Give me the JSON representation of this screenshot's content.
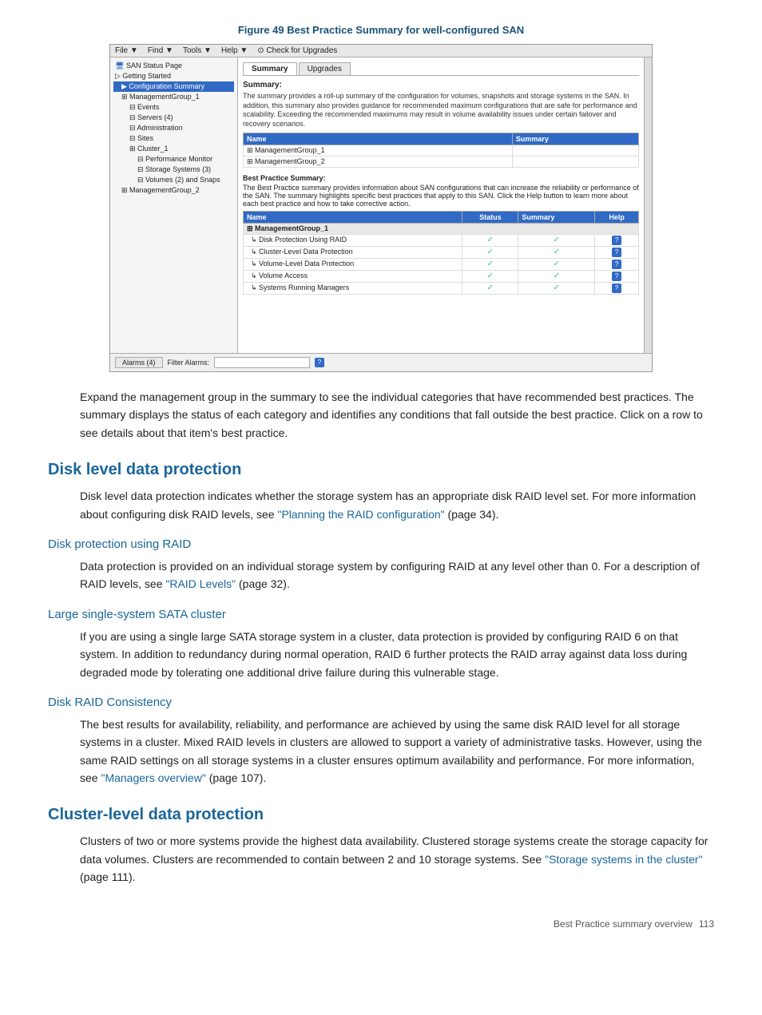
{
  "figure": {
    "caption": "Figure 49 Best Practice Summary for well-configured SAN"
  },
  "screenshot": {
    "menubar": [
      "File ▼",
      "Find ▼",
      "Tools ▼",
      "Help ▼",
      "⊙ Check for Upgrades"
    ],
    "sidebar": {
      "items": [
        {
          "label": "SAN Status Page",
          "level": 0
        },
        {
          "label": "Getting Started",
          "level": 0
        },
        {
          "label": "Configuration Summary",
          "level": 1,
          "selected": true
        },
        {
          "label": "ManagementGroup_1",
          "level": 1
        },
        {
          "label": "Events",
          "level": 2
        },
        {
          "label": "Servers (4)",
          "level": 2
        },
        {
          "label": "Administration",
          "level": 2
        },
        {
          "label": "Sites",
          "level": 2
        },
        {
          "label": "Cluster_1",
          "level": 2
        },
        {
          "label": "Performance Monitor",
          "level": 3
        },
        {
          "label": "Storage Systems (3)",
          "level": 3
        },
        {
          "label": "Volumes (2) and Snaps",
          "level": 3
        },
        {
          "label": "ManagementGroup_2",
          "level": 1
        }
      ]
    },
    "tabs": [
      "Summary",
      "Upgrades"
    ],
    "active_tab": "Summary",
    "summary": {
      "title": "Summary:",
      "description": "The summary provides a roll-up summary of the configuration for volumes, snapshots and storage systems in the SAN. In addition, this summary also provides guidance for recommended maximum configurations that are safe for performance and scalability. Exceeding the recommended maximums may result in volume availability issues under certain failover and recovery scenarios.",
      "table": {
        "headers": [
          "Name",
          "Summary"
        ],
        "rows": [
          {
            "name": "ManagementGroup_1",
            "summary": ""
          },
          {
            "name": "ManagementGroup_2",
            "summary": ""
          }
        ]
      }
    },
    "best_practice": {
      "title": "Best Practice Summary:",
      "description": "The Best Practice summary provides information about SAN configurations that can increase the reliability or performance of the SAN. The summary highlights specific best practices that apply to this SAN. Click the Help button to learn more about each best practice and how to take corrective action.",
      "table": {
        "headers": [
          "Name",
          "Status",
          "Summary",
          "Help"
        ],
        "rows": [
          {
            "name": "ManagementGroup_1",
            "is_header": true
          },
          {
            "name": "Disk Protection Using RAID",
            "status": "✓",
            "summary": "✓",
            "help": "?"
          },
          {
            "name": "Cluster-Level Data Protection",
            "status": "✓",
            "summary": "✓",
            "help": "?"
          },
          {
            "name": "Volume-Level Data Protection",
            "status": "✓",
            "summary": "✓",
            "help": "?"
          },
          {
            "name": "Volume Access",
            "status": "✓",
            "summary": "✓",
            "help": "?"
          },
          {
            "name": "Systems Running Managers",
            "status": "✓",
            "summary": "✓",
            "help": "?"
          }
        ]
      }
    },
    "alarms": {
      "tab_label": "Alarms (4)",
      "filter_label": "Filter Alarms:"
    }
  },
  "body": {
    "expand_text": "Expand the management group in the summary to see the individual categories that have recommended best practices. The summary displays the status of each category and identifies any conditions that fall outside the best practice. Click on a row to see details about that item's best practice.",
    "disk_level": {
      "heading": "Disk level data protection",
      "text": "Disk level data protection indicates whether the storage system has an appropriate disk RAID level set. For more information about configuring disk RAID levels, see ",
      "link_text": "\"Planning the RAID configuration\"",
      "link_page": "(page 34)."
    },
    "disk_protection": {
      "heading": "Disk protection using RAID",
      "text": "Data protection is provided on an individual storage system by configuring RAID at any level other than 0. For a description of RAID levels, see ",
      "link_text": "\"RAID Levels\"",
      "link_page": "(page 32)."
    },
    "large_sata": {
      "heading": "Large single-system SATA cluster",
      "text": "If you are using a single large SATA storage system in a cluster, data protection is provided by configuring RAID 6 on that system. In addition to redundancy during normal operation, RAID 6 further protects the RAID array against data loss during degraded mode by tolerating one additional drive failure during this vulnerable stage."
    },
    "disk_raid": {
      "heading": "Disk RAID Consistency",
      "text": "The best results for availability, reliability, and performance are achieved by using the same disk RAID level for all storage systems in a cluster. Mixed RAID levels in clusters are allowed to support a variety of administrative tasks. However, using the same RAID settings on all storage systems in a cluster ensures optimum availability and performance. For more information, see ",
      "link_text": "\"Managers overview\"",
      "link_page": "(page 107)."
    },
    "cluster_level": {
      "heading": "Cluster-level data protection",
      "text": "Clusters of two or more systems provide the highest data availability. Clustered storage systems create the storage capacity for data volumes. Clusters are recommended to contain between 2 and 10 storage systems. See ",
      "link_text": "\"Storage systems in the cluster\"",
      "link_page": "(page 111)."
    }
  },
  "footer": {
    "text": "Best Practice summary overview",
    "page": "113"
  }
}
